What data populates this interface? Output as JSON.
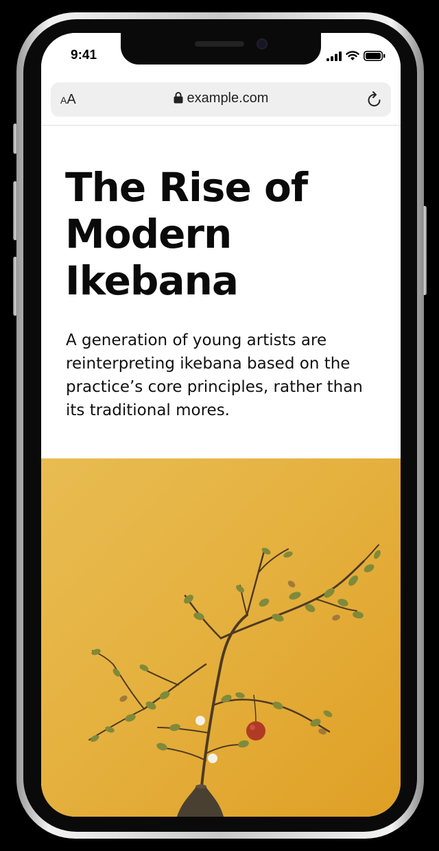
{
  "status_bar": {
    "time": "9:41",
    "icons": [
      "signal-icon",
      "wifi-icon",
      "battery-icon"
    ]
  },
  "browser": {
    "text_size_small": "A",
    "text_size_big": "A",
    "url": "example.com",
    "lock_icon": "lock-icon",
    "reload_icon": "reload-icon"
  },
  "article": {
    "headline": "The Rise of Modern Ikebana",
    "subhead": "A generation of young artists are reinterpreting ikebana based on the practice’s core principles, rather than its traditional mores."
  },
  "hero_image": {
    "subject": "ikebana-arrangement",
    "background_color": "#e5b13f"
  },
  "colors": {
    "page_background": "#ffffff",
    "text": "#0a0a0a",
    "url_bar": "#efefef",
    "hero_gold": "#e5b13f"
  }
}
